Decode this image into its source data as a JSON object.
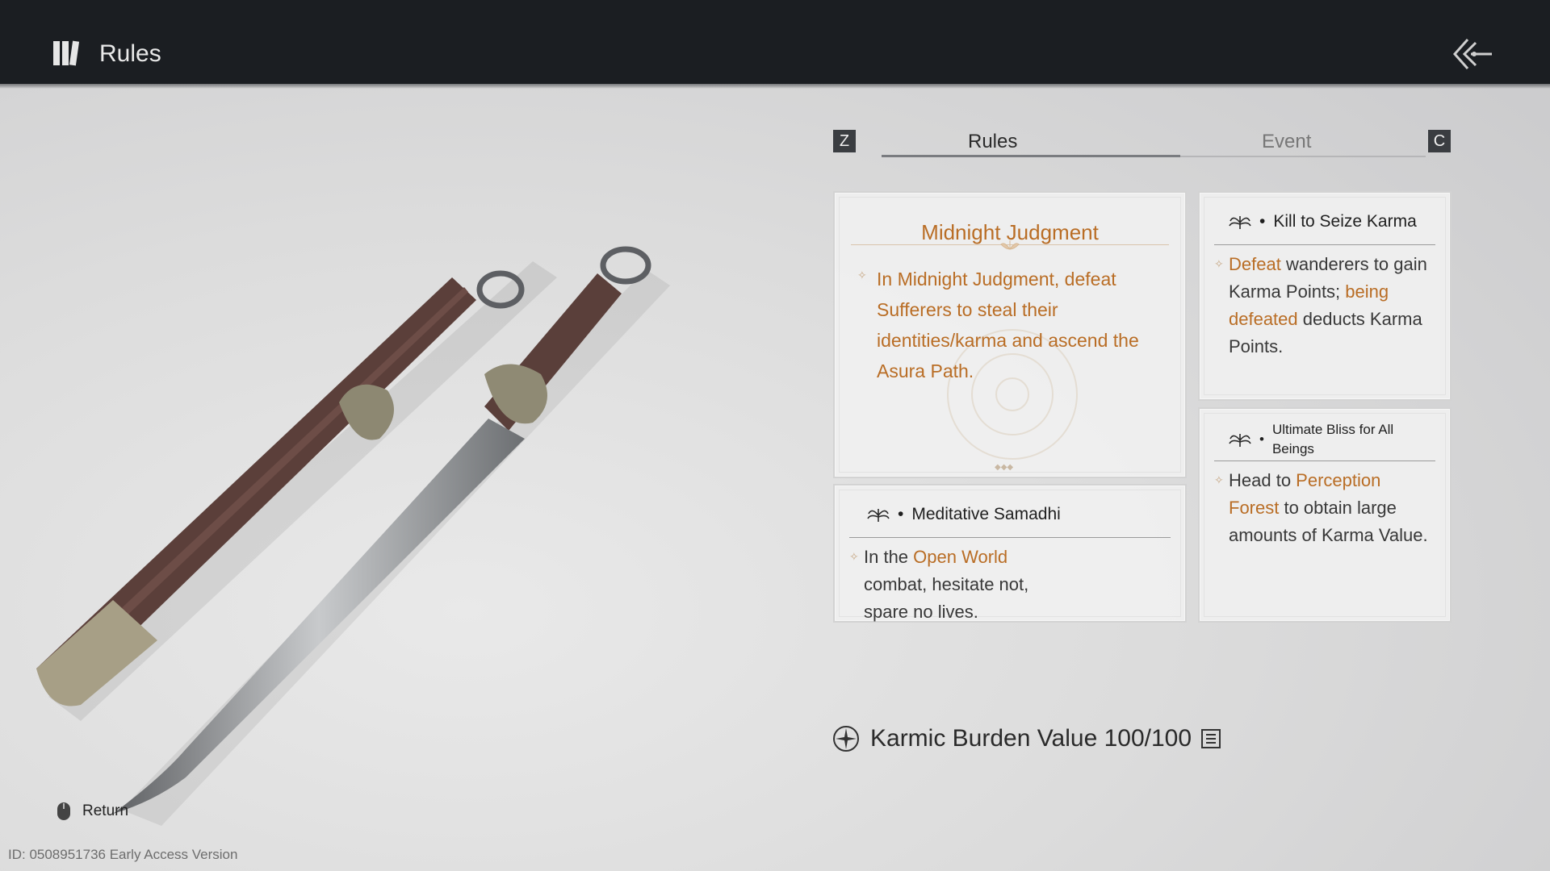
{
  "header": {
    "title": "Rules"
  },
  "tabs": {
    "left_key": "Z",
    "right_key": "C",
    "items": [
      {
        "label": "Rules",
        "active": true
      },
      {
        "label": "Event",
        "active": false
      }
    ]
  },
  "main_card": {
    "title": "Midnight Judgment",
    "body": "In Midnight Judgment, defeat Sufferers to steal their identities/karma and ascend the Asura Path."
  },
  "card_kill": {
    "title": "Kill to Seize Karma",
    "body_parts": {
      "p1": "Defeat",
      "p2": " wanderers to gain Karma Points; ",
      "p3": "being defeated",
      "p4": " deducts Karma Points."
    }
  },
  "card_samadhi": {
    "title": "Meditative Samadhi",
    "body_parts": {
      "p1": "In the ",
      "p2": "Open World",
      "p3": " combat, hesitate not, spare no lives."
    }
  },
  "card_bliss": {
    "title": "Ultimate Bliss for All Beings",
    "body_parts": {
      "p1": "Head to ",
      "p2": "Perception Forest",
      "p3": " to obtain large amounts of Karma Value."
    }
  },
  "karma": {
    "label": "Karmic Burden Value 100/100"
  },
  "footer": {
    "return_label": "Return",
    "id_text": "ID: 0508951736 Early Access Version"
  },
  "colors": {
    "accent": "#b96d25",
    "topbar": "#1b1e22"
  },
  "icons": [
    "book-icon",
    "back-arrow-icon",
    "lotus-icon",
    "sun-emblem-icon",
    "list-icon",
    "mouse-icon",
    "star-bullet-icon"
  ]
}
